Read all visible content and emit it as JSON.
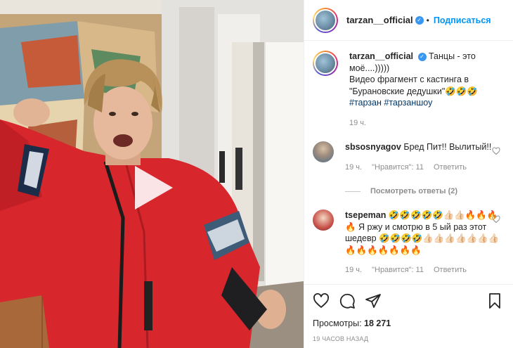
{
  "post": {
    "username": "tarzan__official",
    "follow_label": "Подписаться",
    "caption_line1": "Танцы - это моё....)))))",
    "caption_line2": "Видео фрагмент с кастинга в \"Бурановские дедушки\"🤣🤣🤣",
    "hashtags": [
      "#тарзан",
      "#тарзаншоу"
    ],
    "caption_time": "19 ч."
  },
  "comments": [
    {
      "username": "sbsosnyagov",
      "text": "Бред Пит!! Вылитый!!",
      "time": "19 ч.",
      "likes_label": "\"Нравится\": 11",
      "reply_label": "Ответить",
      "replies_label": "Посмотреть ответы (2)"
    },
    {
      "username": "tsepeman",
      "text": "🤣🤣🤣🤣🤣👍🏻👍🏻🔥🔥🔥🔥 Я ржу и смотрю в 5 ый раз этот шедевр 🤣🤣🤣🤣👍🏻👍🏻👍🏻👍🏻👍🏻👍🏻👍🏻🔥🔥🔥🔥🔥🔥🔥",
      "time": "19 ч.",
      "likes_label": "\"Нравится\": 11",
      "reply_label": "Ответить"
    }
  ],
  "footer": {
    "views_label": "Просмотры:",
    "views_count": "18 271",
    "timestamp": "19 ЧАСОВ НАЗАД"
  },
  "colors": {
    "accent": "#0095f6",
    "verified": "#3897f0",
    "muted": "#8e8e8e",
    "jacket": "#d7262c"
  },
  "icons": [
    "play-icon",
    "verified-icon",
    "heart-icon",
    "comment-icon",
    "share-icon",
    "bookmark-icon"
  ]
}
